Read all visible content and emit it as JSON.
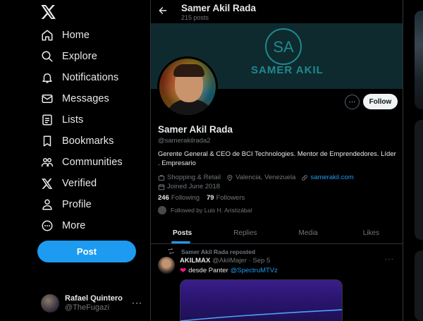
{
  "nav": {
    "items": [
      {
        "label": "Home",
        "icon": "home-icon"
      },
      {
        "label": "Explore",
        "icon": "search-icon"
      },
      {
        "label": "Notifications",
        "icon": "bell-icon"
      },
      {
        "label": "Messages",
        "icon": "mail-icon"
      },
      {
        "label": "Lists",
        "icon": "list-icon"
      },
      {
        "label": "Bookmarks",
        "icon": "bookmark-icon"
      },
      {
        "label": "Communities",
        "icon": "people-icon"
      },
      {
        "label": "Verified",
        "icon": "x-logo-icon"
      },
      {
        "label": "Profile",
        "icon": "person-icon"
      },
      {
        "label": "More",
        "icon": "more-circle-icon"
      }
    ],
    "post_label": "Post",
    "account": {
      "name": "Rafael Quintero",
      "handle": "@TheFugazi",
      "more": "···"
    }
  },
  "header": {
    "name": "Samer Akil Rada",
    "post_count": "215 posts"
  },
  "banner": {
    "text": "SAMER AKIL",
    "monogram": "SA"
  },
  "profile": {
    "more": "···",
    "follow_label": "Follow",
    "name": "Samer Akil Rada",
    "handle": "@samerakilrada2",
    "bio": "Gerente General & CEO de BCI Technologies. Mentor de Emprendedores. Líder . Empresario",
    "category": "Shopping & Retail",
    "location": "Valencia, Venezuela",
    "website": "samerakil.com",
    "joined": "Joined June 2018",
    "following_count": "246",
    "following_label": "Following",
    "followers_count": "79",
    "followers_label": "Followers",
    "followed_by": "Followed by Luis H. Aristizábal"
  },
  "tabs": [
    "Posts",
    "Replies",
    "Media",
    "Likes"
  ],
  "tweet": {
    "repost_text": "Samer Akil Rada reposted",
    "author": "AKILMAX",
    "handle_time": "@AkilMajer · Sep 5",
    "more": "···",
    "text": "desde Panter",
    "mention": "@SpectruMTVz"
  },
  "colors": {
    "accent": "#1d9bf0",
    "background": "#000000",
    "banner": "#0e2a2f",
    "banner_logo": "#1f8a8f"
  }
}
